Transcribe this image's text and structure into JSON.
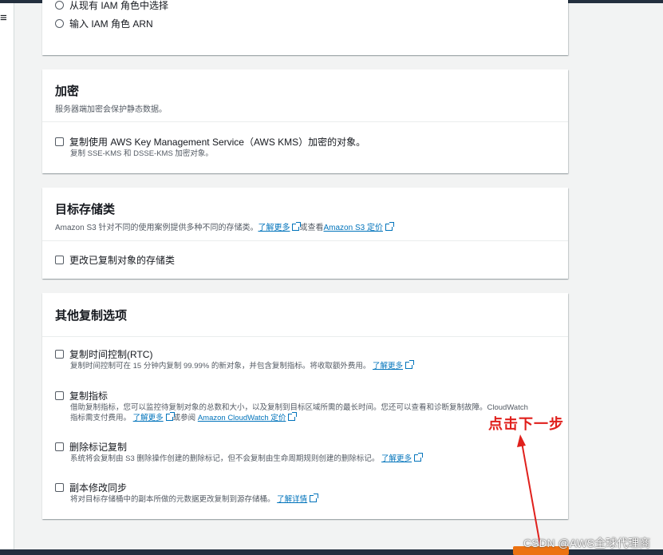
{
  "nav": {
    "menu_icon": "≡"
  },
  "role_section": {
    "option_existing": "从现有 IAM 角色中选择",
    "option_arn": "输入 IAM 角色 ARN"
  },
  "encryption": {
    "title": "加密",
    "description": "服务器端加密会保护静态数据。",
    "kms_label": "复制使用 AWS Key Management Service（AWS KMS）加密的对象。",
    "kms_sub": "复制 SSE-KMS 和 DSSE-KMS 加密对象。"
  },
  "storage_class": {
    "title": "目标存储类",
    "desc_prefix": "Amazon S3 针对不同的使用案例提供多种不同的存储类。",
    "learn_more": "了解更多",
    "desc_mid": "或查看",
    "pricing_link": "Amazon S3 定价",
    "change_label": "更改已复制对象的存储类"
  },
  "other_options": {
    "title": "其他复制选项",
    "rtc": {
      "label": "复制时间控制(RTC)",
      "sub": "复制时间控制可在 15 分钟内复制 99.99% 的新对象，并包含复制指标。将收取额外费用。",
      "link": "了解更多"
    },
    "metrics": {
      "label": "复制指标",
      "sub_line1": "借助复制指标，您可以监控待复制对象的总数和大小，以及复制到目标区域所需的最长时间。您还可以查看和诊断复制故障。CloudWatch",
      "sub_line2": "指标需支付费用。",
      "link1": "了解更多",
      "mid": "或参阅",
      "link2": "Amazon CloudWatch 定价"
    },
    "delete_marker": {
      "label": "删除标记复制",
      "sub": "系统将会复制由 S3 删除操作创建的删除标记，但不会复制由生命周期规则创建的删除标记。",
      "link": "了解更多"
    },
    "replica_sync": {
      "label": "副本修改同步",
      "sub": "将对目标存储桶中的副本所做的元数据更改复制到源存储桶。",
      "link": "了解详情"
    }
  },
  "annotation": {
    "text": "点击下一步",
    "color": "#e0201c"
  },
  "watermark": "CSDN @AWS全球代理商",
  "colors": {
    "link": "#0073bb",
    "primary_button": "#ec7211",
    "topbar": "#232f3e"
  }
}
